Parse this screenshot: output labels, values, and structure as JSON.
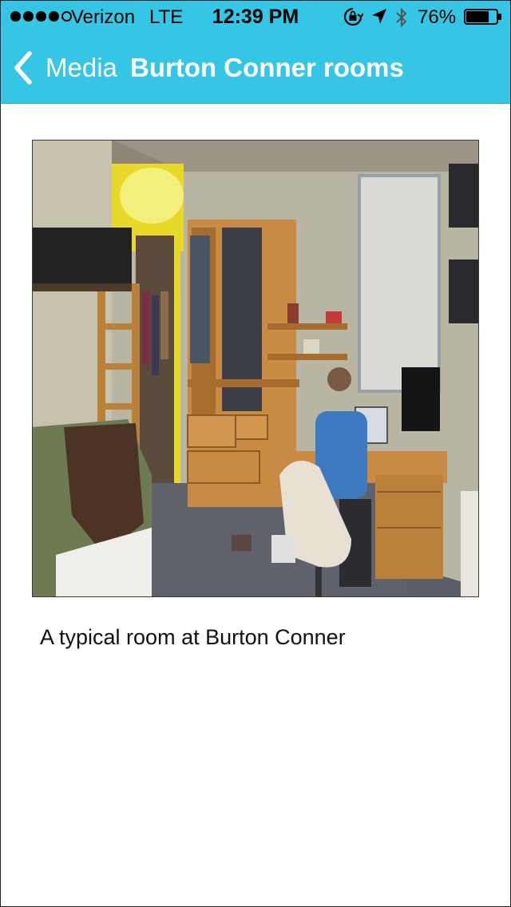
{
  "status_bar": {
    "carrier": "Verizon",
    "network": "LTE",
    "time": "12:39 PM",
    "battery_percent": "76%",
    "battery_level": 0.76,
    "signal_bars_filled": 4,
    "signal_bars_total": 5,
    "icons": [
      "orientation-lock-icon",
      "location-arrow-icon",
      "bluetooth-icon",
      "battery-icon"
    ]
  },
  "nav": {
    "back_label": "Media",
    "title": "Burton Conner rooms"
  },
  "media": {
    "caption": "A typical room at Burton Conner"
  },
  "colors": {
    "nav_background": "#35c5e5",
    "nav_text": "#ffffff",
    "page_background": "#ffffff"
  }
}
